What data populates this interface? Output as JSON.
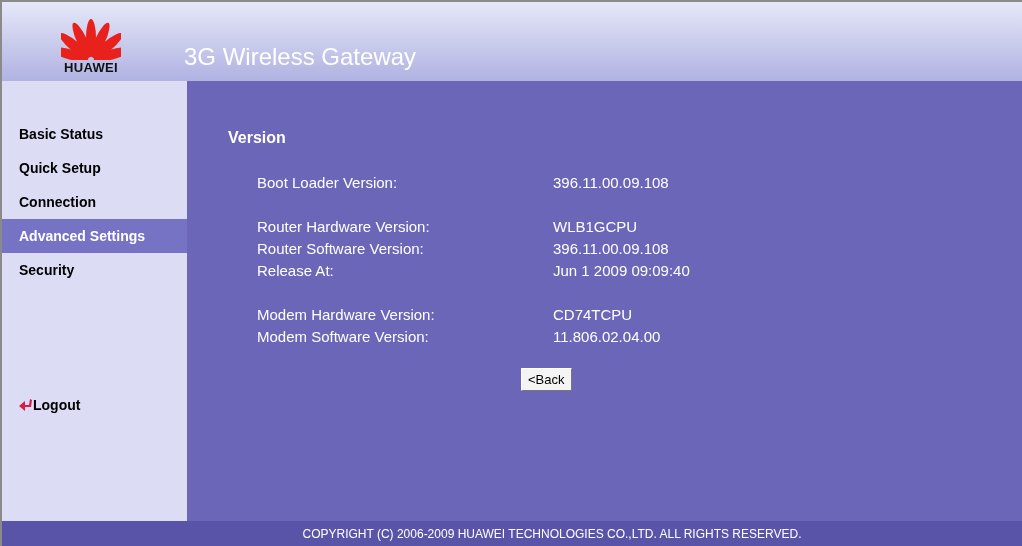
{
  "header": {
    "logo_text": "HUAWEI",
    "title": "3G Wireless Gateway"
  },
  "sidebar": {
    "items": [
      {
        "label": "Basic Status",
        "selected": false
      },
      {
        "label": "Quick Setup",
        "selected": false
      },
      {
        "label": "Connection",
        "selected": false
      },
      {
        "label": "Advanced Settings",
        "selected": true
      },
      {
        "label": "Security",
        "selected": false
      }
    ],
    "logout": "Logout"
  },
  "content": {
    "heading": "Version",
    "groups": [
      [
        {
          "label": "Boot Loader Version:",
          "value": "396.11.00.09.108"
        }
      ],
      [
        {
          "label": "Router Hardware Version:",
          "value": "WLB1GCPU"
        },
        {
          "label": "Router Software Version:",
          "value": "396.11.00.09.108"
        },
        {
          "label": "Release At:",
          "value": "Jun 1 2009 09:09:40"
        }
      ],
      [
        {
          "label": "Modem Hardware Version:",
          "value": "CD74TCPU"
        },
        {
          "label": "Modem Software Version:",
          "value": "11.806.02.04.00"
        }
      ]
    ],
    "back_button": "<Back"
  },
  "footer": "COPYRIGHT (C) 2006-2009 HUAWEI TECHNOLOGIES CO.,LTD. ALL RIGHTS RESERVED."
}
